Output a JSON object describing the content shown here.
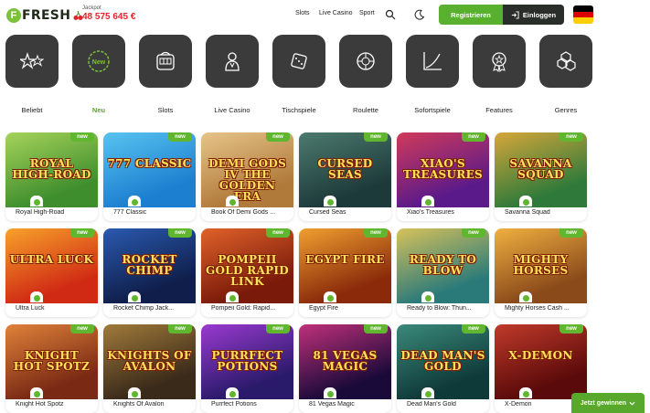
{
  "header": {
    "logo_text": "FRESH",
    "logo_letter": "F",
    "jackpot_label": "Jackpot",
    "jackpot_value": "48 575 645 €",
    "nav": [
      "Slots",
      "Live Casino",
      "Sport"
    ],
    "register_label": "Registrieren",
    "login_label": "Einloggen",
    "flag_colors": [
      "#000000",
      "#dd0000",
      "#ffce00"
    ]
  },
  "categories": [
    {
      "label": "Beliebt",
      "icon": "stars-icon"
    },
    {
      "label": "Neu",
      "icon": "new-icon",
      "active": true
    },
    {
      "label": "Slots",
      "icon": "slot-machine-icon"
    },
    {
      "label": "Live Casino",
      "icon": "dealer-icon"
    },
    {
      "label": "Tischspiele",
      "icon": "dice-icon"
    },
    {
      "label": "Roulette",
      "icon": "roulette-icon"
    },
    {
      "label": "Sofortspiele",
      "icon": "chart-icon"
    },
    {
      "label": "Features",
      "icon": "badge-icon"
    },
    {
      "label": "Genres",
      "icon": "cubes-icon"
    }
  ],
  "badge_label": "new",
  "games": [
    {
      "name": "Royal High-Road",
      "art": "ROYAL HIGH-ROAD",
      "bg": "#3f8e2e",
      "bg2": "#a6d35a"
    },
    {
      "name": "777 Classic",
      "art": "777 CLASSIC",
      "bg": "#1c7fd0",
      "bg2": "#58c3f0"
    },
    {
      "name": "Book Of Demi Gods ...",
      "art": "DEMI GODS IV THE GOLDEN ERA",
      "bg": "#b07a3a",
      "bg2": "#e6c48a"
    },
    {
      "name": "Cursed Seas",
      "art": "CURSED SEAS",
      "bg": "#1d3a3a",
      "bg2": "#4c7a6e"
    },
    {
      "name": "Xiao's Treasures",
      "art": "XIAO'S TREASURES",
      "bg": "#5a1a8a",
      "bg2": "#d03a5a"
    },
    {
      "name": "Savanna Squad",
      "art": "SAVANNA SQUAD",
      "bg": "#2f7a3a",
      "bg2": "#d6a63a"
    },
    {
      "name": "Ultra Luck",
      "art": "ULTRA LUCK",
      "bg": "#d02a14",
      "bg2": "#f7a22a"
    },
    {
      "name": "Rocket Chimp Jack...",
      "art": "ROCKET CHIMP",
      "bg": "#0f1e4a",
      "bg2": "#2a5ab0"
    },
    {
      "name": "Pompeii Gold: Rapid...",
      "art": "POMPEII GOLD RAPID LINK",
      "bg": "#7a1a0a",
      "bg2": "#e0622a"
    },
    {
      "name": "Egypt Fire",
      "art": "EGYPT FIRE",
      "bg": "#8a2a0a",
      "bg2": "#f0a030"
    },
    {
      "name": "Ready to Blow: Thun...",
      "art": "READY TO BLOW",
      "bg": "#2a7a7a",
      "bg2": "#d6c25a"
    },
    {
      "name": "Mighty Horses Cash ...",
      "art": "MIGHTY HORSES",
      "bg": "#8a4a1a",
      "bg2": "#f0b040"
    },
    {
      "name": "Knight Hot Spotz",
      "art": "KNIGHT HOT SPOTZ",
      "bg": "#7a2a14",
      "bg2": "#e0823a"
    },
    {
      "name": "Knights Of Avalon",
      "art": "KNIGHTS OF AVALON",
      "bg": "#3a2a1a",
      "bg2": "#a07a3a"
    },
    {
      "name": "Purrfect Potions",
      "art": "PURRFECT POTIONS",
      "bg": "#2a1a6a",
      "bg2": "#9a3ad0"
    },
    {
      "name": "81 Vegas Magic",
      "art": "81 VEGAS MAGIC",
      "bg": "#1a0a3a",
      "bg2": "#c0307a"
    },
    {
      "name": "Dead Man's Gold",
      "art": "DEAD MAN'S GOLD",
      "bg": "#0f3a3a",
      "bg2": "#3a8a7a"
    },
    {
      "name": "X-Demon",
      "art": "X-DEMON",
      "bg": "#5a0a0a",
      "bg2": "#c03a2a"
    }
  ],
  "cta_label": "Jetzt gewinnen"
}
